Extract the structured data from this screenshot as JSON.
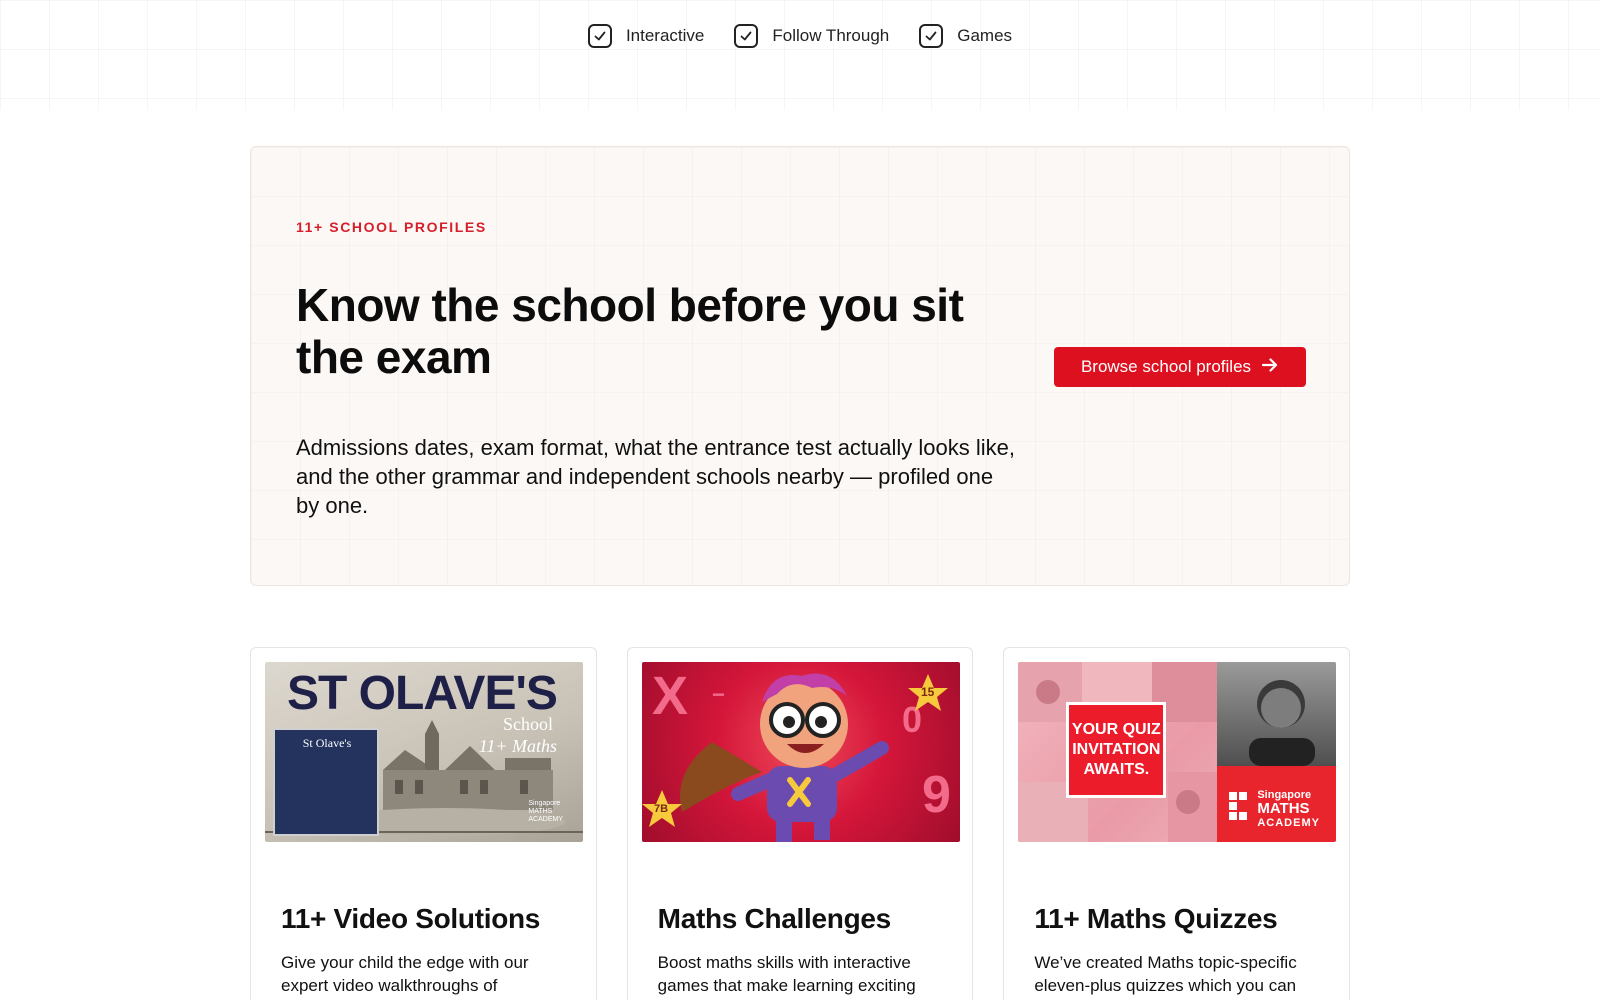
{
  "features": [
    {
      "label": "Interactive",
      "icon": "check-icon"
    },
    {
      "label": "Follow Through",
      "icon": "check-icon"
    },
    {
      "label": "Games",
      "icon": "check-icon"
    }
  ],
  "profiles": {
    "eyebrow": "11+ SCHOOL PROFILES",
    "headline": "Know the school before you sit the exam",
    "lead": "Admissions dates, exam format, what the entrance test actually looks like, and the other grammar and independent schools nearby — profiled one by one.",
    "cta_label": "Browse school profiles",
    "cta_icon": "arrow-right-icon"
  },
  "cards": [
    {
      "title": "11+ Video Solutions",
      "description": "Give your child the edge with our expert video walkthroughs of",
      "thumb": {
        "big_text": "ST OLAVE'S",
        "school_word": "School",
        "maths_word": "11+ Maths",
        "sign_title": "St Olave's",
        "logo_lines": [
          "Singapore",
          "MATHS",
          "ACADEMY"
        ]
      }
    },
    {
      "title": "Maths Challenges",
      "description": "Boost maths skills with interactive games that make learning exciting",
      "thumb": {
        "badge_a": "15",
        "badge_b": "7B"
      }
    },
    {
      "title": "11+ Maths Quizzes",
      "description": "We’ve created Maths topic-specific eleven-plus quizzes which you can",
      "thumb": {
        "quiz_text": "YOUR QUIZ INVITATION AWAITS.",
        "brand_lines": [
          "Singapore",
          "MATHS",
          "ACADEMY"
        ]
      }
    }
  ],
  "colors": {
    "accent": "#dd1020",
    "eyebrow": "#d61f2c",
    "card_bg": "#fcf8f5"
  }
}
